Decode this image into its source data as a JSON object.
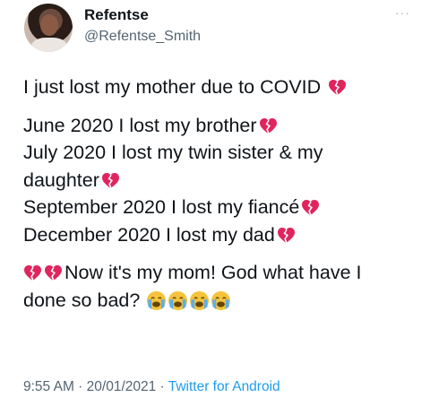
{
  "author": {
    "display_name": "Refentse",
    "handle": "@Refentse_Smith",
    "avatar_icon": "profile-photo"
  },
  "more_menu": {
    "label": "···",
    "icon": "more-dots-icon"
  },
  "tweet": {
    "lines": [
      "I just lost my mother due to COVID",
      "June 2020 I lost my brother",
      "July 2020 I lost my twin sister & my",
      "daughter",
      "September 2020 I lost my fiancé",
      "December 2020 I lost my dad",
      "Now it's my mom! God what have I",
      "done so bad?"
    ],
    "emoji": {
      "broken_heart": "broken-heart-icon",
      "crying": "loudly-crying-face-icon",
      "heart_color": "#e0245e",
      "cry_face_color": "#f5c33b",
      "tear_color": "#5dadec"
    }
  },
  "meta": {
    "time": "9:55 AM",
    "sep1": " · ",
    "date": "20/01/2021",
    "sep2": " · ",
    "source": "Twitter for Android"
  }
}
